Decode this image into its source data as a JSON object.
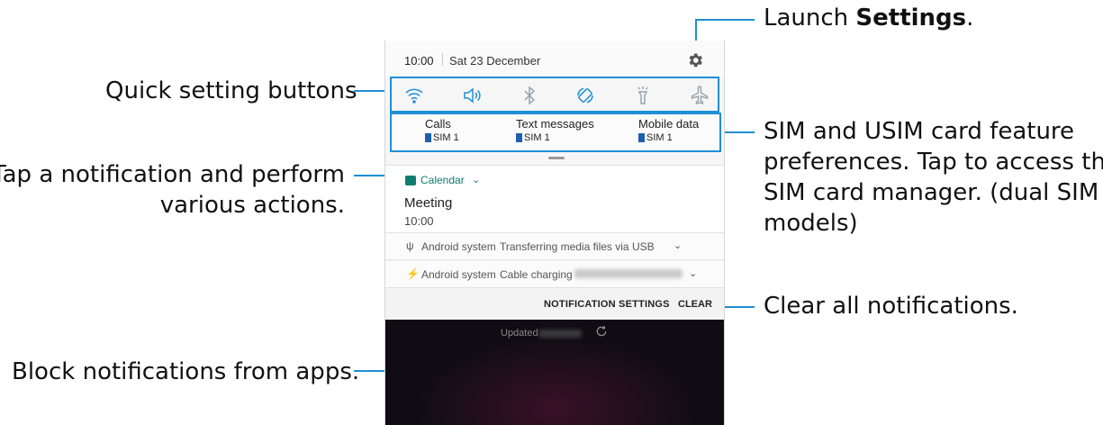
{
  "annotations": {
    "settings_prefix": "Launch ",
    "settings_bold": "Settings",
    "settings_suffix": ".",
    "quick_settings": "Quick setting buttons",
    "notification_line1": "Tap a notification and perform",
    "notification_line2": "various actions.",
    "sim_line1": "SIM and USIM card feature",
    "sim_line2": "preferences. Tap to access the",
    "sim_line3": "SIM card manager. (dual SIM",
    "sim_line4": "models)",
    "clear": "Clear all notifications.",
    "block": "Block notifications from apps."
  },
  "status_bar": {
    "time": "10:00",
    "date": "Sat 23 December"
  },
  "quick_settings": [
    {
      "name": "wifi-icon"
    },
    {
      "name": "sound-icon"
    },
    {
      "name": "bluetooth-icon"
    },
    {
      "name": "auto-rotate-icon"
    },
    {
      "name": "flashlight-icon"
    },
    {
      "name": "airplane-mode-icon"
    }
  ],
  "sim_preferences": [
    {
      "title": "Calls",
      "sim": "SIM 1"
    },
    {
      "title": "Text messages",
      "sim": "SIM 1"
    },
    {
      "title": "Mobile data",
      "sim": "SIM 1"
    }
  ],
  "notification": {
    "app": "Calendar",
    "title": "Meeting",
    "time": "10:00"
  },
  "system_notifications": [
    {
      "app": "Android system",
      "message": "Transferring media files via USB"
    },
    {
      "app": "Android system",
      "message": "Cable charging"
    }
  ],
  "actions": {
    "notification_settings": "NOTIFICATION SETTINGS",
    "clear": "CLEAR"
  },
  "lock_screen": {
    "updated_label": "Updated"
  },
  "colors": {
    "accent": "#1f8fd6",
    "calendar": "#0d7e6f",
    "lock_screen_bg": "#0f0c14"
  }
}
